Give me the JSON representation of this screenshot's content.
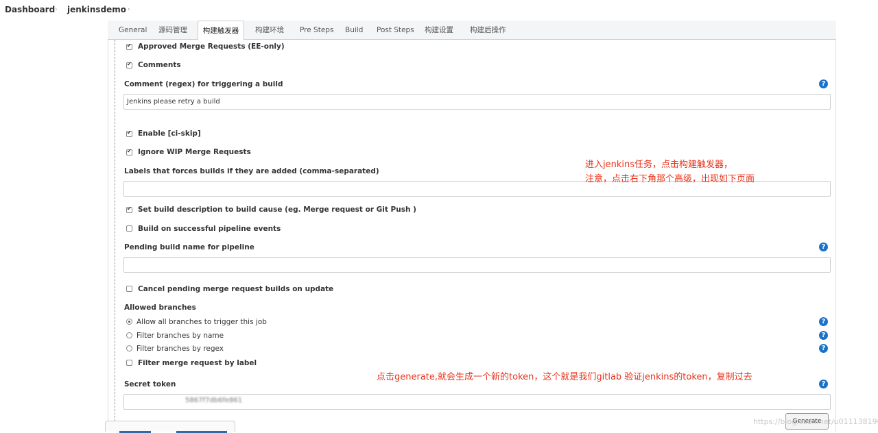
{
  "breadcrumb": {
    "items": [
      "Dashboard",
      "jenkinsdemo"
    ],
    "separator": "›"
  },
  "tabs": [
    "General",
    "源码管理",
    "构建触发器",
    "构建环境",
    "Pre Steps",
    "Build",
    "Post Steps",
    "构建设置",
    "构建后操作"
  ],
  "active_tab": "构建触发器",
  "form": {
    "approved_merge_requests": {
      "label": "Approved Merge Requests (EE-only)",
      "checked": true
    },
    "comments": {
      "label": "Comments",
      "checked": true
    },
    "comment_regex_label": "Comment (regex) for triggering a build",
    "comment_regex_value": "Jenkins please retry a build",
    "enable_ci_skip": {
      "label": "Enable [ci-skip]",
      "checked": true
    },
    "ignore_wip": {
      "label": "Ignore WIP Merge Requests",
      "checked": true
    },
    "labels_force_label": "Labels that forces builds if they are added (comma-separated)",
    "labels_force_value": "",
    "set_build_description": {
      "label": "Set build description to build cause (eg. Merge request or Git Push )",
      "checked": true
    },
    "build_on_pipeline": {
      "label": "Build on successful pipeline events",
      "checked": false
    },
    "pending_build_name_label": "Pending build name for pipeline",
    "pending_build_name_value": "",
    "cancel_pending": {
      "label": "Cancel pending merge request builds on update",
      "checked": false
    },
    "allowed_branches_label": "Allowed branches",
    "branch_options": [
      {
        "label": "Allow all branches to trigger this job",
        "selected": true
      },
      {
        "label": "Filter branches by name",
        "selected": false
      },
      {
        "label": "Filter branches by regex",
        "selected": false
      }
    ],
    "filter_merge_request": {
      "label": "Filter merge request by label",
      "checked": false
    },
    "secret_token_label": "Secret token",
    "secret_token_value": "5867f7db6fe861",
    "generate_label": "Generate",
    "help_glyph": "?"
  },
  "annotations": {
    "note1_line1": "进入jenkins任务，点击构建触发器，",
    "note1_line2": "注意，点击右下角那个高级，出现如下页面",
    "note2": "点击generate,就会生成一个新的token，这个就是我们gitlab 验证jenkins的token，复制过去"
  },
  "watermark": "https://blog.csdn.net/u011138190",
  "colors": {
    "annotation": "#e8331b",
    "help_icon": "#1a73c9",
    "tab_bar": "#f3f5f6"
  }
}
